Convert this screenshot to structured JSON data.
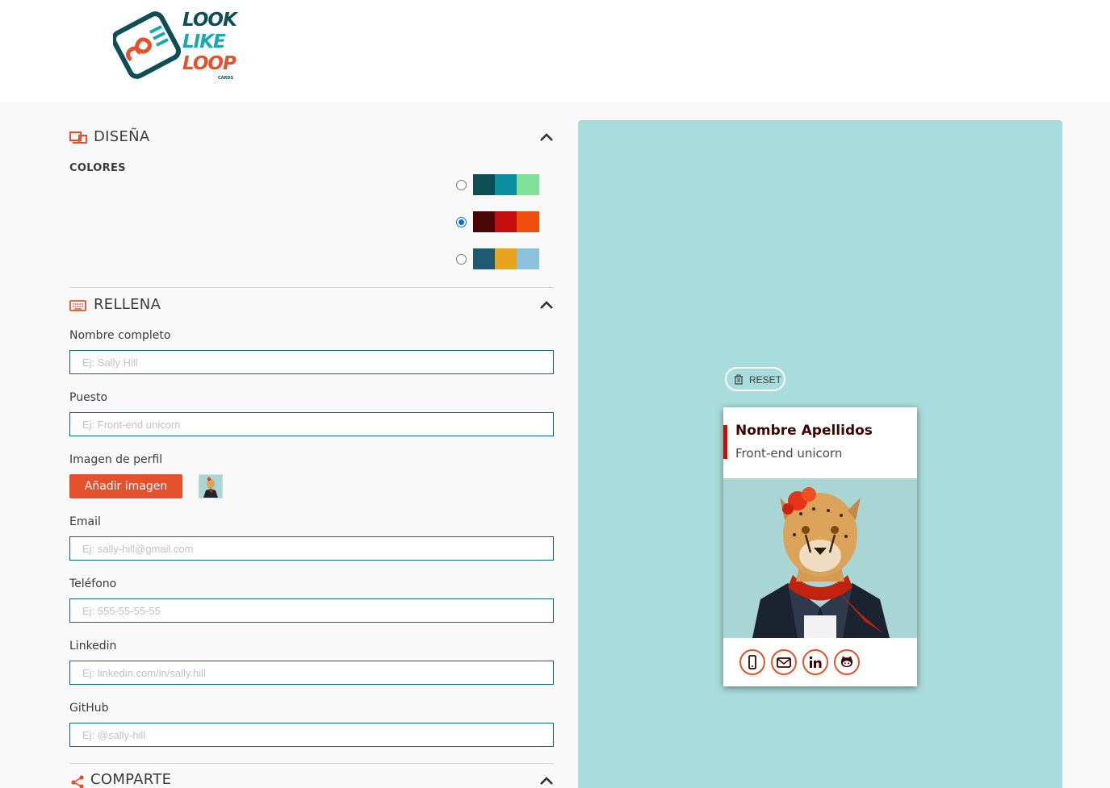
{
  "header": {
    "logo_line1": "LOOK",
    "logo_line2": "LIKE",
    "logo_line3": "LOOP",
    "logo_sub": "CARDS"
  },
  "design": {
    "title": "DISEÑA",
    "colors_label": "COLORES",
    "palettes": [
      {
        "colors": [
          "#0c4e53",
          "#0a8fa0",
          "#80e29a"
        ],
        "selected": false
      },
      {
        "colors": [
          "#4a0505",
          "#c40d0d",
          "#f04e0d"
        ],
        "selected": true
      },
      {
        "colors": [
          "#1f5a72",
          "#e7a41c",
          "#8cc2dc"
        ],
        "selected": false
      }
    ]
  },
  "fill": {
    "title": "RELLENA",
    "name": {
      "label": "Nombre completo",
      "placeholder": "Ej: Sally Hill",
      "value": ""
    },
    "job": {
      "label": "Puesto",
      "placeholder": "Ej: Front-end unicorn",
      "value": ""
    },
    "image": {
      "label": "Imagen de perfil",
      "button": "Añadir imagen"
    },
    "email": {
      "label": "Email",
      "placeholder": "Ej: sally-hill@gmail.com",
      "value": ""
    },
    "phone": {
      "label": "Teléfono",
      "placeholder": "Ej: 555-55-55-55",
      "value": ""
    },
    "linkedin": {
      "label": "Linkedin",
      "placeholder": "Ej: linkedin.com/in/sally.hill",
      "value": ""
    },
    "github": {
      "label": "GitHub",
      "placeholder": "Ej: @sally-hill",
      "value": ""
    }
  },
  "share": {
    "title": "COMPARTE"
  },
  "preview": {
    "reset_label": "RESET",
    "card_name": "Nombre Apellidos",
    "card_job": "Front-end unicorn",
    "icons": [
      "phone-icon",
      "mail-icon",
      "linkedin-icon",
      "github-icon"
    ]
  },
  "colors": {
    "accent": "#e5512c",
    "preview_bg": "#a9dcdc",
    "input_border": "#0e6a70"
  }
}
